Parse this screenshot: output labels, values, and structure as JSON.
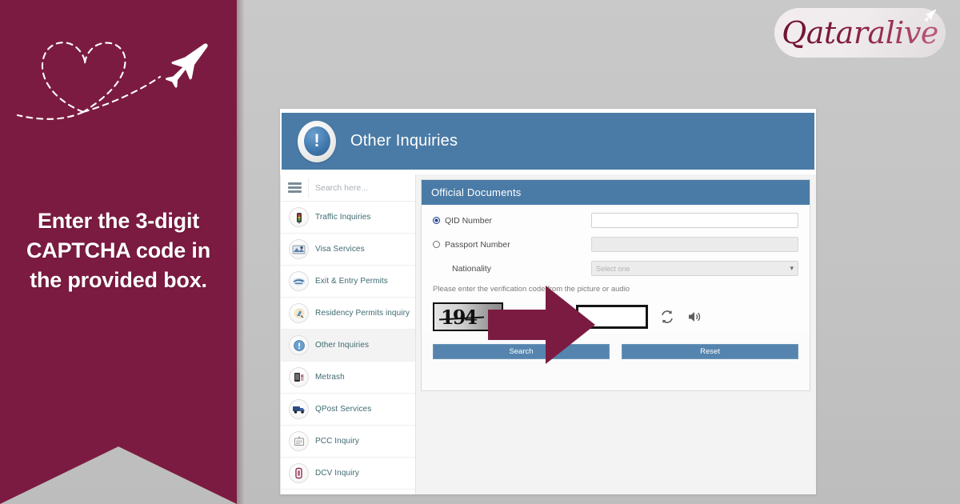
{
  "promo": {
    "headline": "Enter the 3-digit CAPTCHA code in the provided box.",
    "brand": "Qataralive",
    "brand_colors": {
      "maroon": "#7c1b41",
      "accent_pink": "#c05f80",
      "background_gray": "#c6c6c6"
    },
    "decor": {
      "heart_path_icon": "dashed-heart-flight-path-icon",
      "plane_icon": "airplane-icon",
      "logo_plane_icon": "logo-airplane-icon"
    }
  },
  "screenshot": {
    "header": {
      "title": "Other Inquiries",
      "icon": "exclamation-circle-icon",
      "bar_color": "#4a7ba6"
    },
    "sidebar": {
      "menu_icon": "hamburger-menu-icon",
      "search_placeholder": "Search here...",
      "search_value": "",
      "items": [
        {
          "label": "Traffic Inquiries",
          "icon": "traffic-light-icon",
          "active": false
        },
        {
          "label": "Visa Services",
          "icon": "visa-stamp-icon",
          "active": false
        },
        {
          "label": "Exit & Entry Permits",
          "icon": "exit-entry-icon",
          "active": false
        },
        {
          "label": "Residency Permits inquiry",
          "icon": "residency-permit-icon",
          "active": false
        },
        {
          "label": "Other Inquiries",
          "icon": "exclamation-circle-icon",
          "active": true
        },
        {
          "label": "Metrash",
          "icon": "metrash-phone-icon",
          "active": false
        },
        {
          "label": "QPost Services",
          "icon": "post-truck-icon",
          "active": false
        },
        {
          "label": "PCC Inquiry",
          "icon": "certificate-icon",
          "active": false
        },
        {
          "label": "DCV Inquiry",
          "icon": "document-verify-icon",
          "active": false
        }
      ]
    },
    "form": {
      "panel_title": "Official Documents",
      "qid_label": "QID Number",
      "qid_selected": true,
      "qid_value": "",
      "passport_label": "Passport Number",
      "passport_selected": false,
      "passport_value": "",
      "nationality_label": "Nationality",
      "nationality_value": "Select one",
      "nationality_chevron": "chevron-down-icon",
      "verification_hint": "Please enter the verification code from the picture or audio",
      "captcha_code": "194",
      "captcha_input_value": "",
      "refresh_icon": "refresh-captcha-icon",
      "audio_icon": "speaker-audio-icon",
      "search_button": "Search",
      "reset_button": "Reset"
    }
  },
  "annotation": {
    "arrow_icon": "pointer-arrow-right-icon",
    "arrow_color": "#7c1b41"
  }
}
